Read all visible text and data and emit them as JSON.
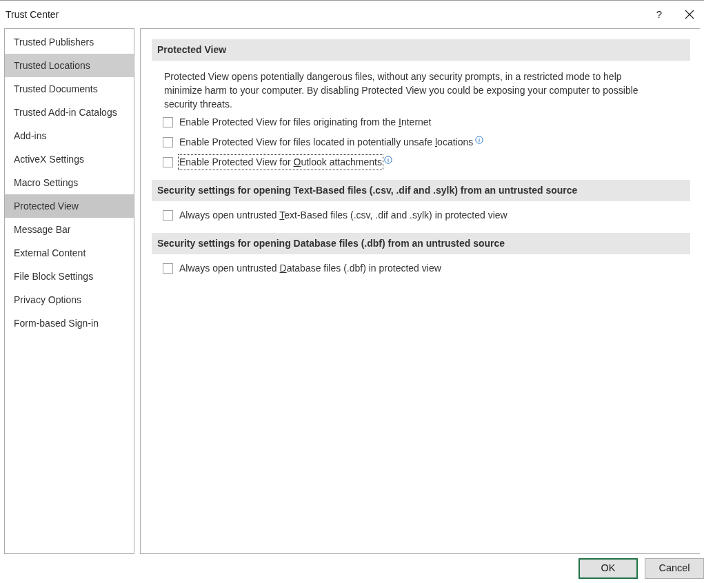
{
  "window": {
    "title": "Trust Center",
    "help": "?"
  },
  "sidebar": {
    "items": [
      {
        "label": "Trusted Publishers",
        "selected": false,
        "hovered": false
      },
      {
        "label": "Trusted Locations",
        "selected": false,
        "hovered": true
      },
      {
        "label": "Trusted Documents",
        "selected": false,
        "hovered": false
      },
      {
        "label": "Trusted Add-in Catalogs",
        "selected": false,
        "hovered": false
      },
      {
        "label": "Add-ins",
        "selected": false,
        "hovered": false
      },
      {
        "label": "ActiveX Settings",
        "selected": false,
        "hovered": false
      },
      {
        "label": "Macro Settings",
        "selected": false,
        "hovered": false
      },
      {
        "label": "Protected View",
        "selected": true,
        "hovered": false
      },
      {
        "label": "Message Bar",
        "selected": false,
        "hovered": false
      },
      {
        "label": "External Content",
        "selected": false,
        "hovered": false
      },
      {
        "label": "File Block Settings",
        "selected": false,
        "hovered": false
      },
      {
        "label": "Privacy Options",
        "selected": false,
        "hovered": false
      },
      {
        "label": "Form-based Sign-in",
        "selected": false,
        "hovered": false
      }
    ]
  },
  "sections": [
    {
      "heading": "Protected View",
      "description": "Protected View opens potentially dangerous files, without any security prompts, in a restricted mode to help minimize harm to your computer. By disabling Protected View you could be exposing your computer to possible security threats.",
      "options": [
        {
          "label_before": "Enable Protected View for files originating from the ",
          "access_key": "I",
          "label_after": "nternet",
          "checked": false,
          "focused": false,
          "info": false
        },
        {
          "label_before": "Enable Protected View for files located in potentially unsafe ",
          "access_key": "l",
          "label_after": "ocations",
          "checked": false,
          "focused": false,
          "info": true
        },
        {
          "label_before": "Enable Protected View for ",
          "access_key": "O",
          "label_after": "utlook attachments",
          "checked": false,
          "focused": true,
          "info": true
        }
      ]
    },
    {
      "heading": "Security settings for opening Text-Based files (.csv, .dif and .sylk) from an untrusted source",
      "options": [
        {
          "label_before": "Always open untrusted ",
          "access_key": "T",
          "label_after": "ext-Based files (.csv, .dif and .sylk) in protected view",
          "checked": false,
          "focused": false,
          "info": false
        }
      ]
    },
    {
      "heading": "Security settings for opening Database files (.dbf) from an untrusted source",
      "options": [
        {
          "label_before": "Always open untrusted ",
          "access_key": "D",
          "label_after": "atabase files (.dbf) in protected view",
          "checked": false,
          "focused": false,
          "info": false
        }
      ]
    }
  ],
  "buttons": [
    {
      "label": "OK",
      "default": true
    },
    {
      "label": "Cancel",
      "default": false
    }
  ]
}
